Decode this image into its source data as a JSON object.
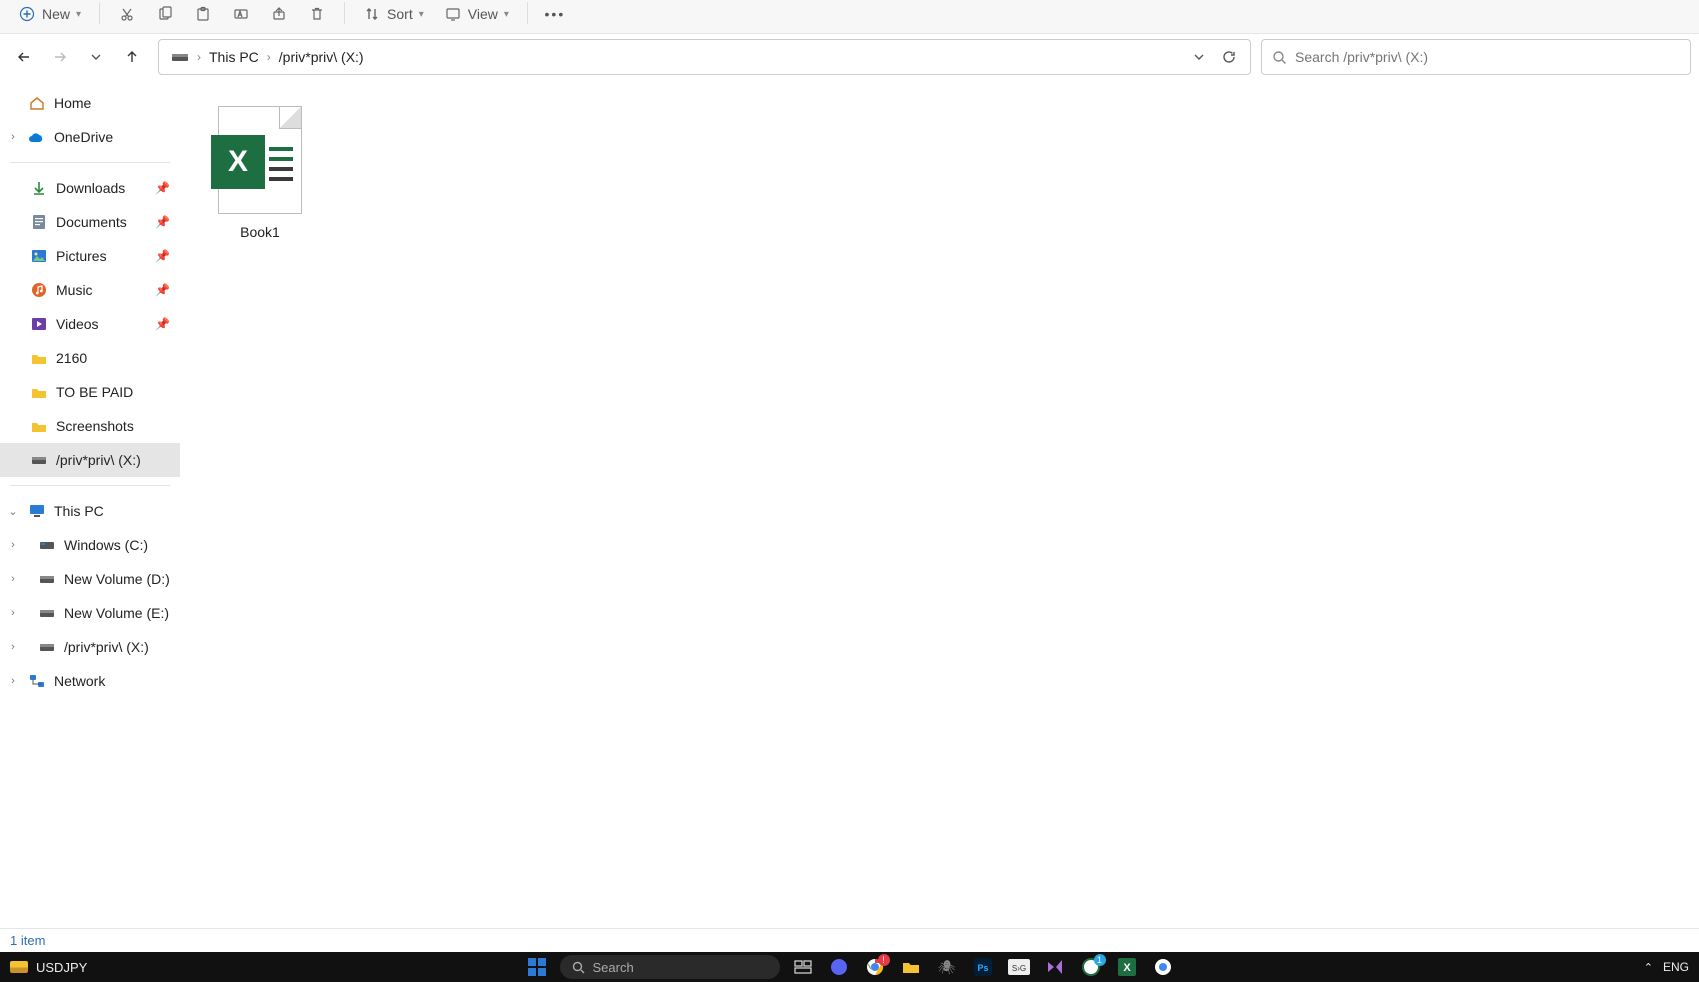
{
  "toolbar": {
    "new_label": "New",
    "sort_label": "Sort",
    "view_label": "View"
  },
  "nav": {
    "breadcrumb": [
      {
        "label": "This PC"
      },
      {
        "label": "/priv*priv\\ (X:)"
      }
    ]
  },
  "search": {
    "placeholder": "Search /priv*priv\\ (X:)"
  },
  "sidebar": {
    "home": "Home",
    "onedrive": "OneDrive",
    "quick": [
      {
        "label": "Downloads",
        "pinned": true
      },
      {
        "label": "Documents",
        "pinned": true
      },
      {
        "label": "Pictures",
        "pinned": true
      },
      {
        "label": "Music",
        "pinned": true
      },
      {
        "label": "Videos",
        "pinned": true
      },
      {
        "label": "2160",
        "pinned": false
      },
      {
        "label": "TO BE PAID",
        "pinned": false
      },
      {
        "label": "Screenshots",
        "pinned": false
      },
      {
        "label": "/priv*priv\\ (X:)",
        "pinned": false,
        "active": true
      }
    ],
    "thispc": "This PC",
    "drives": [
      {
        "label": "Windows (C:)"
      },
      {
        "label": "New Volume (D:)"
      },
      {
        "label": "New Volume (E:)"
      },
      {
        "label": "/priv*priv\\ (X:)"
      }
    ],
    "network": "Network"
  },
  "files": [
    {
      "name": "Book1",
      "type": "excel"
    }
  ],
  "status": {
    "text": "1 item"
  },
  "taskbar": {
    "ticker": "USDJPY",
    "search": "Search",
    "lang": "ENG"
  }
}
